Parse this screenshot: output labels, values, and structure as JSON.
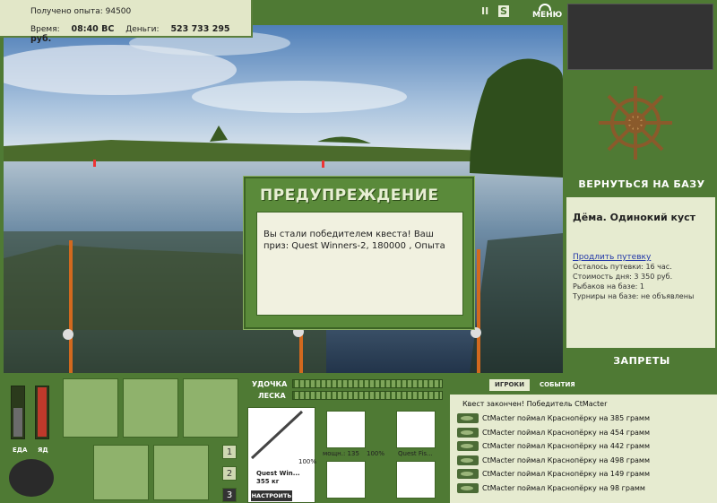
{
  "stats": {
    "experience_label": "Получено опыта:",
    "experience_value": "94500",
    "time_label": "Время:",
    "time_value": "08:40 ВС",
    "money_label": "Деньги:",
    "money_value": "523 733 295 руб."
  },
  "topbar": {
    "pause_icon": "II",
    "sound_icon": "S",
    "menu_label": "МЕНЮ"
  },
  "dialog": {
    "title": "ПРЕДУПРЕЖДЕНИЕ",
    "message": "Вы стали победителем квеста! Ваш приз: Quest Winners-2, 180000 , Опыта"
  },
  "right_panel": {
    "return_label": "ВЕРНУТЬСЯ НА БАЗУ",
    "location": "Дёма. Одинокий куст",
    "extend_link": "Продлить путевку",
    "remaining": "Осталось путевки: 16 час.",
    "day_cost": "Стоимость дня: 3 350 руб.",
    "fishers": "Рыбаков на базе: 1",
    "tournaments": "Турниры на базе: не объявлены",
    "bans_label": "ЗАПРЕТЫ"
  },
  "bottom": {
    "food_label": "ЕДА",
    "poison_label": "ЯД",
    "food_level": 0.55,
    "poison_level": 0.95,
    "pages": [
      "1",
      "2",
      "3"
    ],
    "rod_label": "УДОЧКА",
    "line_label": "ЛЕСКА",
    "rod_name": "Quest Win...",
    "rod_weight": "355 кг",
    "rod_percent": "100%",
    "reel_caption": "мощн.: 135",
    "reel_percent": "100%",
    "line_caption": "Quest Fis...",
    "setup_button": "НАСТРОИТЬ"
  },
  "log": {
    "tab_players": "ИГРОКИ",
    "tab_events": "СОБЫТИЯ",
    "header": "Квест закончен! Победитель CtMacter",
    "events": [
      "CtMacter поймал Краснопёрку на 385 грамм",
      "CtMacter поймал Краснопёрку на 454 грамм",
      "CtMacter поймал Краснопёрку на 442 грамм",
      "CtMacter поймал Краснопёрку на 498 грамм",
      "CtMacter поймал Краснопёрку на 149 грамм",
      "CtMacter поймал Краснопёрку на 98 грамм"
    ]
  },
  "colors": {
    "panel_green": "#4f7a34",
    "panel_light": "#e6ebd0",
    "dialog_green": "#5a8a3a",
    "link_blue": "#2136a8"
  }
}
